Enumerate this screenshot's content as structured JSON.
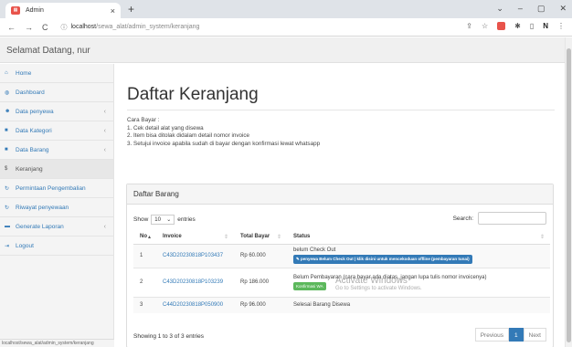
{
  "browser": {
    "tab_title": "Admin",
    "tab_close": "×",
    "new_tab": "+",
    "url_host": "localhost",
    "url_path": "/sewa_alat/admin_system/keranjang",
    "window_controls": [
      "⌄",
      "–",
      "▢",
      "✕"
    ]
  },
  "header": {
    "welcome": "Selamat Datang, nur"
  },
  "sidebar": {
    "items": [
      {
        "label": "Home",
        "icon": "home-icon",
        "glyph": "⌂",
        "chev": ""
      },
      {
        "label": "Dashboard",
        "icon": "dashboard-icon",
        "glyph": "◍",
        "chev": ""
      },
      {
        "label": "Data penyewa",
        "icon": "users-icon",
        "glyph": "☻",
        "chev": "‹"
      },
      {
        "label": "Data Kategori",
        "icon": "list-icon",
        "glyph": "■",
        "chev": "‹"
      },
      {
        "label": "Data Barang",
        "icon": "list-icon",
        "glyph": "■",
        "chev": "‹"
      },
      {
        "label": "Keranjang",
        "icon": "dollar-icon",
        "glyph": "$",
        "chev": ""
      },
      {
        "label": "Permintaan Pengembalian",
        "icon": "refresh-icon",
        "glyph": "↻",
        "chev": ""
      },
      {
        "label": "Riwayat penyewaan",
        "icon": "refresh-icon",
        "glyph": "↻",
        "chev": ""
      },
      {
        "label": "Generate Laporan",
        "icon": "chart-icon",
        "glyph": "▬",
        "chev": "‹"
      },
      {
        "label": "Logout",
        "icon": "logout-icon",
        "glyph": "⇥",
        "chev": ""
      }
    ],
    "status_url": "localhost/sewa_alat/admin_system/keranjang"
  },
  "main": {
    "title": "Daftar Keranjang",
    "instructions": [
      "Cara Bayar :",
      "1. Cek detail alat yang disewa",
      "2. Item bisa ditolak didalam detail nomor invoice",
      "3. Setujui invoice apabila sudah di bayar dengan konfirmasi lewat whatsapp"
    ],
    "panel_title": "Daftar Barang",
    "show_label": "Show",
    "entries_value": "10",
    "entries_label": "entries",
    "search_label": "Search:",
    "columns": [
      "No",
      "Invoice",
      "Total Bayar",
      "Status"
    ],
    "rows": [
      {
        "no": "1",
        "invoice": "C43D20230818P103437",
        "total": "Rp 60.000",
        "status": "belum Check Out",
        "button": "penyewa Belum Check Out | klik disini untuk mencekoduan offline (pembayaran tunai)"
      },
      {
        "no": "2",
        "invoice": "C43D20230818P103239",
        "total": "Rp 186.000",
        "status": "Belum Pembayaran (cara bayar ada diatas, jangan lupa tulis nomor invoicenya)",
        "button": "Konfirmasi WA"
      },
      {
        "no": "3",
        "invoice": "C44D20230818P050900",
        "total": "Rp 96.000",
        "status": "Selesai Barang Disewa",
        "button": ""
      }
    ],
    "showing": "Showing 1 to 3 of 3 entries",
    "pager": [
      "Previous",
      "1",
      "Next"
    ]
  },
  "watermark": {
    "line1": "Activate Windows",
    "line2": "Go to Settings to activate Windows."
  }
}
